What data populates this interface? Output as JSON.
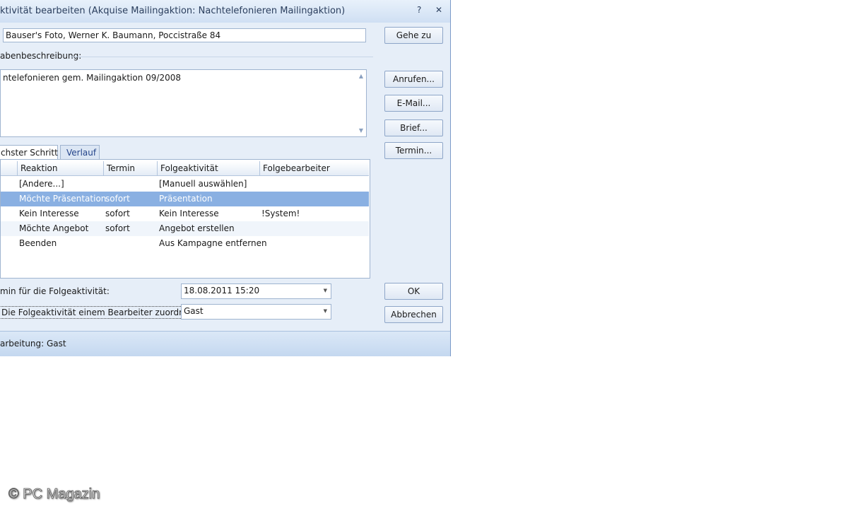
{
  "window": {
    "title": "ktivität bearbeiten (Akquise Mailingaktion: Nachtelefonieren Mailingaktion)",
    "help_symbol": "?",
    "close_symbol": "✕"
  },
  "contact": {
    "value": "Bauser's Foto, Werner K. Baumann, Poccistraße 84"
  },
  "description": {
    "section_label": "abenbeschreibung:",
    "text": "ntelefonieren gem. Mailingaktion 09/2008"
  },
  "buttons": {
    "goto": "Gehe zu",
    "call": "Anrufen...",
    "email": "E-Mail...",
    "letter": "Brief...",
    "appointment": "Termin...",
    "ok": "OK",
    "cancel": "Abbrechen"
  },
  "tabs": [
    {
      "label": "chster Schritt",
      "active": true
    },
    {
      "label": "Verlauf",
      "active": false
    }
  ],
  "grid": {
    "columns": [
      "",
      "Reaktion",
      "Termin",
      "Folgeaktivität",
      "Folgebearbeiter"
    ],
    "rows": [
      {
        "reaktion": "[Andere...]",
        "termin": "",
        "folge": "[Manuell auswählen]",
        "bearbeiter": ""
      },
      {
        "reaktion": "Möchte Präsentation",
        "termin": "sofort",
        "folge": "Präsentation",
        "bearbeiter": ""
      },
      {
        "reaktion": "Kein Interesse",
        "termin": "sofort",
        "folge": "Kein Interesse",
        "bearbeiter": "!System!"
      },
      {
        "reaktion": "Möchte Angebot",
        "termin": "sofort",
        "folge": "Angebot erstellen",
        "bearbeiter": ""
      },
      {
        "reaktion": "Beenden",
        "termin": "",
        "folge": "Aus Kampagne entfernen",
        "bearbeiter": ""
      }
    ]
  },
  "schedule": {
    "label": "min für die Folgeaktivität:",
    "value": "18.08.2011 15:20"
  },
  "assign": {
    "label": "Die Folgeaktivität einem Bearbeiter zuordnen:",
    "value": "Gast"
  },
  "status": {
    "text": "arbeitung: Gast"
  },
  "watermark": "© PC Magazin",
  "icons": {
    "scroll_up": "▲",
    "scroll_down": "▼",
    "dropdown": "▼"
  },
  "colors": {
    "selection": "#8ab0e2",
    "dialog_background": "#e6eef8"
  }
}
